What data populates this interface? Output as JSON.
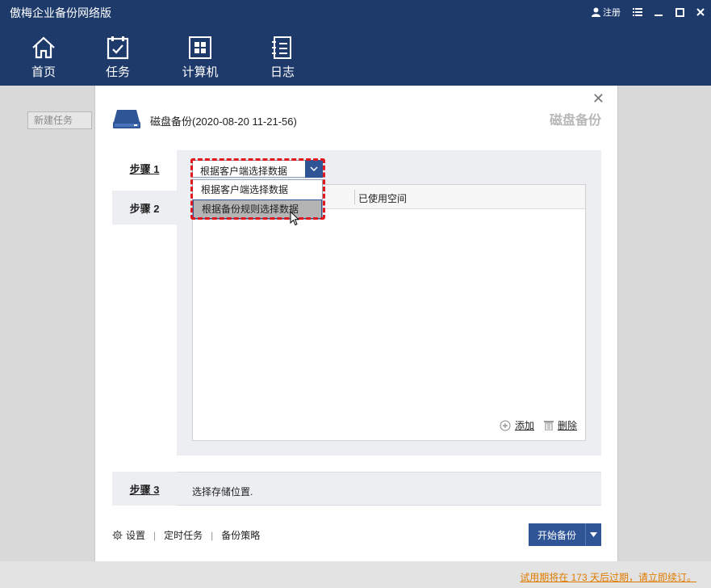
{
  "app": {
    "title": "傲梅企业备份网络版",
    "login": "注册"
  },
  "nav": {
    "items": [
      {
        "label": "首页",
        "icon": "home-icon"
      },
      {
        "label": "任务",
        "icon": "task-checklist-icon"
      },
      {
        "label": "计算机",
        "icon": "windows-icon"
      },
      {
        "label": "日志",
        "icon": "log-icon"
      }
    ]
  },
  "sidebar": {
    "new_task": "新建任务"
  },
  "dialog": {
    "title": "磁盘备份(2020-08-20 11-21-56)",
    "subtitle": "磁盘备份",
    "close": "✕",
    "steps": [
      {
        "label": "步骤 1"
      },
      {
        "label": "步骤 2"
      },
      {
        "label": "步骤 3"
      }
    ],
    "combo": {
      "selected": "根据客户端选择数据",
      "options": [
        "根据客户端选择数据",
        "根据备份规则选择数据"
      ],
      "highlighted_option_index": 1
    },
    "table": {
      "column_used": "已使用空间",
      "add": "添加",
      "delete": "删除"
    },
    "step3_text": "选择存储位置.",
    "footer": {
      "settings": "设置",
      "schedule": "定时任务",
      "strategy": "备份策略",
      "start": "开始备份"
    }
  },
  "status": {
    "trial": "试用期将在 173 天后过期，请立即续订。"
  },
  "colors": {
    "header": "#1d3a6b",
    "accent": "#2f5597",
    "highlight": "#e0191e",
    "trial": "#e07b00"
  }
}
